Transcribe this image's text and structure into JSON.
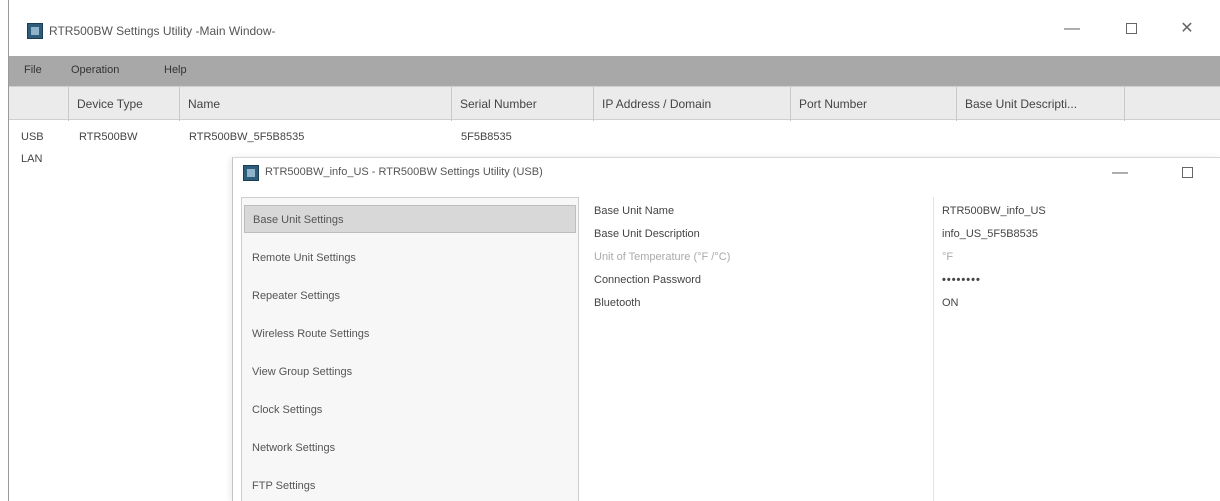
{
  "main_window": {
    "title": "RTR500BW Settings Utility -Main Window-",
    "controls": {
      "minimize": "—",
      "close": "✕"
    },
    "menu": [
      "File",
      "Operation",
      "Help"
    ],
    "columns": [
      "Device Type",
      "Name",
      "Serial Number",
      "IP Address / Domain",
      "Port Number",
      "Base Unit Descripti..."
    ],
    "rows": [
      {
        "conn": "USB",
        "device_type": "RTR500BW",
        "name": "RTR500BW_5F5B8535",
        "serial": "5F5B8535"
      },
      {
        "conn": "LAN"
      }
    ]
  },
  "child_window": {
    "title": "RTR500BW_info_US - RTR500BW Settings Utility (USB)",
    "controls": {
      "minimize": "—"
    },
    "nav": [
      "Base Unit Settings",
      "Remote Unit Settings",
      "Repeater Settings",
      "Wireless Route Settings",
      "View Group Settings",
      "Clock Settings",
      "Network Settings",
      "FTP Settings"
    ],
    "selected_nav_index": 0,
    "properties": [
      {
        "label": "Base Unit Name",
        "value": "RTR500BW_info_US",
        "disabled": false
      },
      {
        "label": "Base Unit Description",
        "value": "info_US_5F5B8535",
        "disabled": false
      },
      {
        "label": "Unit of Temperature (°F /°C)",
        "value": "°F",
        "disabled": true
      },
      {
        "label": "Connection Password",
        "value": "••••••••",
        "disabled": false
      },
      {
        "label": "Bluetooth",
        "value": "ON",
        "disabled": false
      }
    ]
  },
  "icons": {
    "app": "app-icon",
    "minimize": "minimize-icon",
    "maximize": "maximize-icon",
    "close": "close-icon"
  },
  "colors": {
    "menu_bar": "#a8a8a8",
    "header_bg": "#ebebeb",
    "selected_nav": "#d8d8d8",
    "disabled_text": "#aaaaaa"
  }
}
